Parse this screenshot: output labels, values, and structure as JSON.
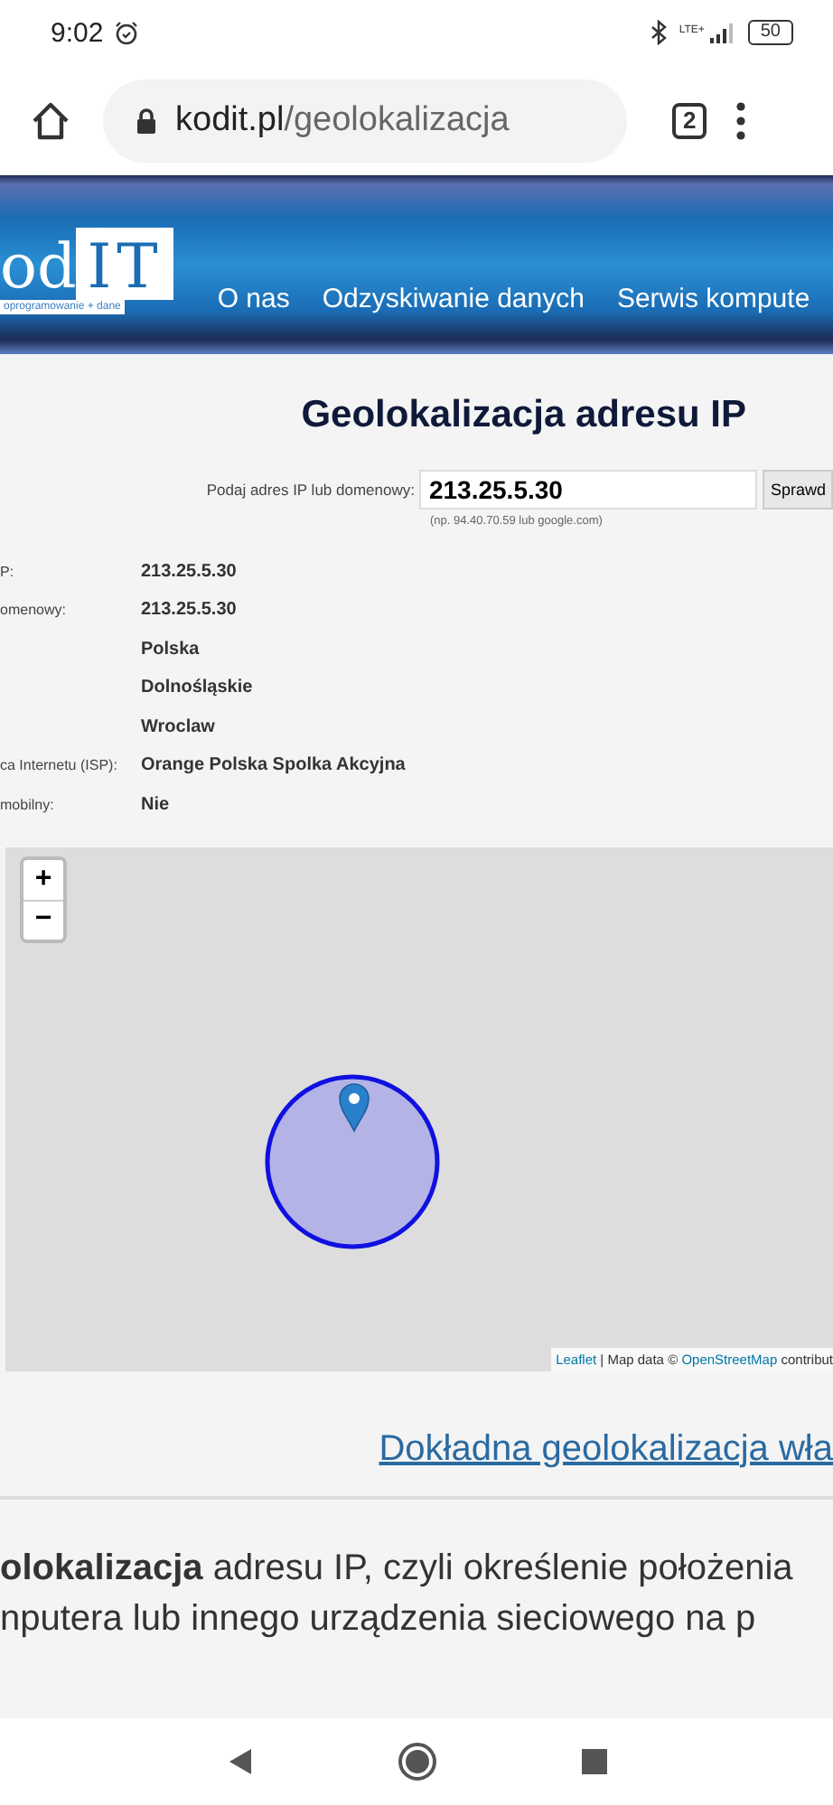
{
  "status_bar": {
    "time": "9:02",
    "network": "LTE+",
    "battery": "50"
  },
  "browser": {
    "url_domain": "kodit.pl",
    "url_path": "/geolokalizacja",
    "tab_count": "2"
  },
  "header": {
    "logo_left": "od",
    "logo_right": "IT",
    "tagline": "oprogramowanie + dane",
    "nav": [
      {
        "label": "O nas"
      },
      {
        "label": "Odzyskiwanie danych"
      },
      {
        "label": "Serwis kompute"
      }
    ]
  },
  "title": "Geolokalizacja adresu IP",
  "form": {
    "label": "Podaj adres IP lub domenowy:",
    "value": "213.25.5.30",
    "button": "Sprawd",
    "hint": "(np. 94.40.70.59 lub google.com)"
  },
  "results": [
    {
      "label": "P:",
      "value": "213.25.5.30"
    },
    {
      "label": "omenowy:",
      "value": "213.25.5.30"
    },
    {
      "value": "Polska"
    },
    {
      "value": "Dolnośląskie"
    },
    {
      "value": "Wroclaw"
    },
    {
      "label": "ca Internetu (ISP):",
      "value": "Orange Polska Spolka Akcyjna"
    },
    {
      "label": "mobilny:",
      "value": "Nie"
    }
  ],
  "map": {
    "zoom_in": "+",
    "zoom_out": "−",
    "attribution": [
      {
        "text": "Leaflet",
        "kind": "link"
      },
      {
        "text": " | Map data © ",
        "kind": "text"
      },
      {
        "text": "OpenStreetMap",
        "kind": "link"
      },
      {
        "text": " contribut",
        "kind": "text"
      }
    ]
  },
  "link": "Dokładna geolokalizacja wła",
  "paragraph": [
    "**olokalizacja** adresu IP, czyli określenie położenia",
    "nputera lub innego urządzenia sieciowego na p"
  ]
}
